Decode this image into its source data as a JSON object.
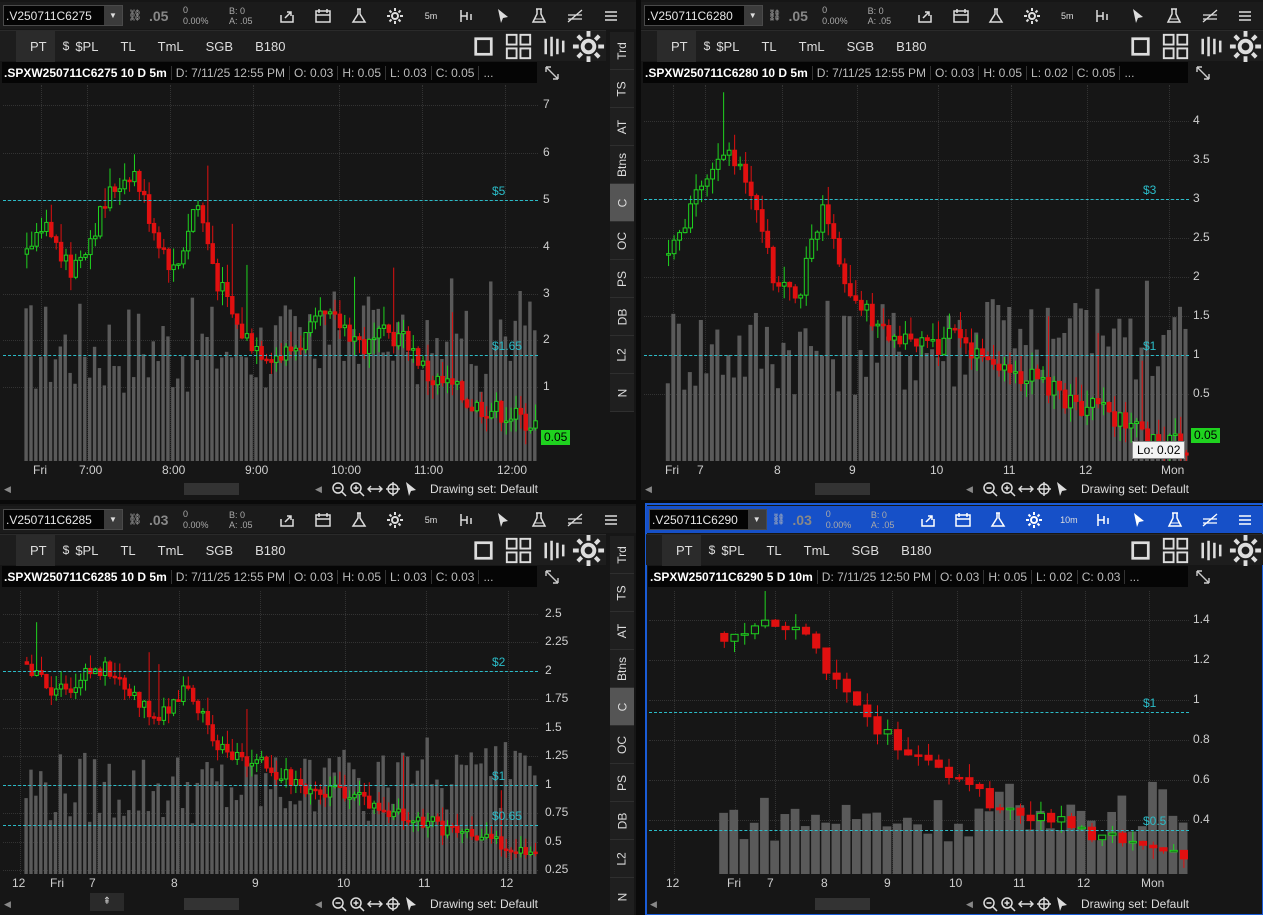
{
  "colors": {
    "up": "#1fd21f",
    "down": "#e01010",
    "volume": "#5a5a5a",
    "level": "#2bbcc8",
    "accent": "#1650c8"
  },
  "common": {
    "pt": "PT",
    "spl": "$PL",
    "tl": "TL",
    "tml": "TmL",
    "sgb": "SGB",
    "b180": "B180",
    "drawing": "Drawing set: Default",
    "ha": "B: 0",
    "ask": "A: .05",
    "chg1": "0",
    "chg2": "0.00%",
    "aggr_btn": "≫"
  },
  "tabs": [
    "Trd",
    "TS",
    "AT",
    "Btns",
    "C",
    "OC",
    "PS",
    "DB",
    "L2",
    "N"
  ],
  "panels": [
    {
      "symbol": ".V250711C6275",
      "last": ".05",
      "agg": "5m",
      "bid": "B: 0",
      "ask": "A: .05",
      "header": {
        "sym": ".SPXW250711C6275 10 D 5m",
        "d": "D: 7/11/25 12:55 PM",
        "o": "O: 0.03",
        "h": "H: 0.05",
        "l": "L: 0.03",
        "c": "C: 0.05",
        "more": "..."
      },
      "yticks": [
        "7",
        "6",
        "5",
        "4",
        "3",
        "2",
        "1"
      ],
      "xticks": [
        "Fri",
        "7:00",
        "8:00",
        "9:00",
        "10:00",
        "11:00",
        "12:00"
      ],
      "levels": [
        {
          "label": "$5"
        },
        {
          "label": "$1.65"
        }
      ],
      "price": "0.05"
    },
    {
      "symbol": ".V250711C6280",
      "last": ".05",
      "agg": "5m",
      "bid": "B: 0",
      "ask": "A: .05",
      "header": {
        "sym": ".SPXW250711C6280 10 D 5m",
        "d": "D: 7/11/25 12:55 PM",
        "o": "O: 0.03",
        "h": "H: 0.05",
        "l": "L: 0.02",
        "c": "C: 0.05",
        "more": "..."
      },
      "yticks": [
        "4",
        "3.5",
        "3",
        "2.5",
        "2",
        "1.5",
        "1",
        "0.5"
      ],
      "xticks": [
        "Fri",
        "7",
        "8",
        "9",
        "10",
        "11",
        "12",
        "Mon"
      ],
      "levels": [
        {
          "label": "$3"
        },
        {
          "label": "$1"
        }
      ],
      "price": "0.05",
      "tooltip": "Lo: 0.02"
    },
    {
      "symbol": ".V250711C6285",
      "last": ".03",
      "agg": "5m",
      "bid": "B: 0",
      "ask": "A: .05",
      "header": {
        "sym": ".SPXW250711C6285 10 D 5m",
        "d": "D: 7/11/25 12:55 PM",
        "o": "O: 0.03",
        "h": "H: 0.05",
        "l": "L: 0.03",
        "c": "C: 0.03",
        "more": "..."
      },
      "yticks": [
        "2.5",
        "2.25",
        "2",
        "1.75",
        "1.5",
        "1.25",
        "1",
        "0.75",
        "0.5",
        "0.25"
      ],
      "xticks": [
        "12",
        "Fri",
        "7",
        "8",
        "9",
        "10",
        "11",
        "12"
      ],
      "levels": [
        {
          "label": "$2"
        },
        {
          "label": "$1"
        },
        {
          "label": "$0.65"
        }
      ]
    },
    {
      "symbol": ".V250711C6290",
      "last": ".03",
      "agg": "10m",
      "bid": "B: 0",
      "ask": "A: .05",
      "header": {
        "sym": ".SPXW250711C6290 5 D 10m",
        "d": "D: 7/11/25 12:50 PM",
        "o": "O: 0.03",
        "h": "H: 0.05",
        "l": "L: 0.02",
        "c": "C: 0.03",
        "more": "..."
      },
      "yticks": [
        "1.4",
        "1.2",
        "1",
        "0.8",
        "0.6",
        "0.4"
      ],
      "xticks": [
        "12",
        "Fri",
        "7",
        "8",
        "9",
        "10",
        "11",
        "12",
        "Mon"
      ],
      "levels": [
        {
          "label": "$1"
        },
        {
          "label": "$0.5"
        }
      ]
    }
  ]
}
